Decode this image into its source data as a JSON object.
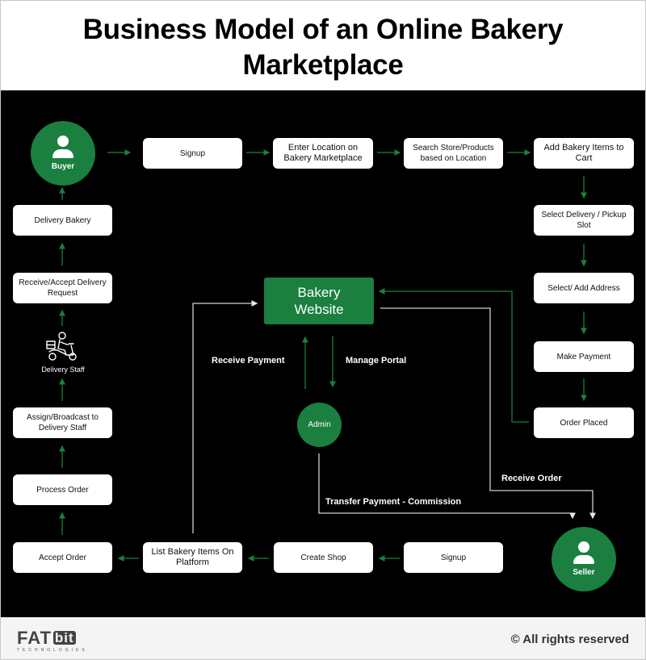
{
  "header": {
    "title_line1": "Business Model of an Online Bakery",
    "title_line2": "Marketplace"
  },
  "colors": {
    "accent": "#1a7f3f",
    "background": "#000000",
    "box": "#ffffff",
    "connector_white": "#d0d0d0",
    "footer_bg": "#f4f4f4"
  },
  "actors": {
    "buyer": {
      "label": "Buyer",
      "icon": "user-icon"
    },
    "seller": {
      "label": "Seller",
      "icon": "user-icon"
    },
    "admin": {
      "label": "Admin"
    },
    "delivery_staff": {
      "label": "Delivery Staff",
      "icon": "delivery-scooter-icon"
    }
  },
  "center": {
    "website_line1": "Bakery",
    "website_line2": "Website"
  },
  "buyer_flow": [
    "Signup",
    "Enter Location on Bakery Marketplace",
    "Search Store/Products based on Location",
    "Add Bakery Items to Cart",
    "Select Delivery / Pickup Slot",
    "Select/ Add Address",
    "Make Payment",
    "Order Placed"
  ],
  "seller_flow": [
    "Signup",
    "Create Shop",
    "List Bakery Items On Platform",
    "Accept Order",
    "Process Order",
    "Assign/Broadcast to Delivery Staff",
    "Receive/Accept Delivery Request",
    "Delivery Bakery"
  ],
  "edge_labels": {
    "receive_payment": "Receive Payment",
    "manage_portal": "Manage Portal",
    "receive_order": "Receive Order",
    "transfer_payment": "Transfer Payment - Commission"
  },
  "footer": {
    "logo_main": "FAT",
    "logo_bit": "bit",
    "logo_sub": "TECHNOLOGIES",
    "copyright": "© All rights reserved"
  }
}
